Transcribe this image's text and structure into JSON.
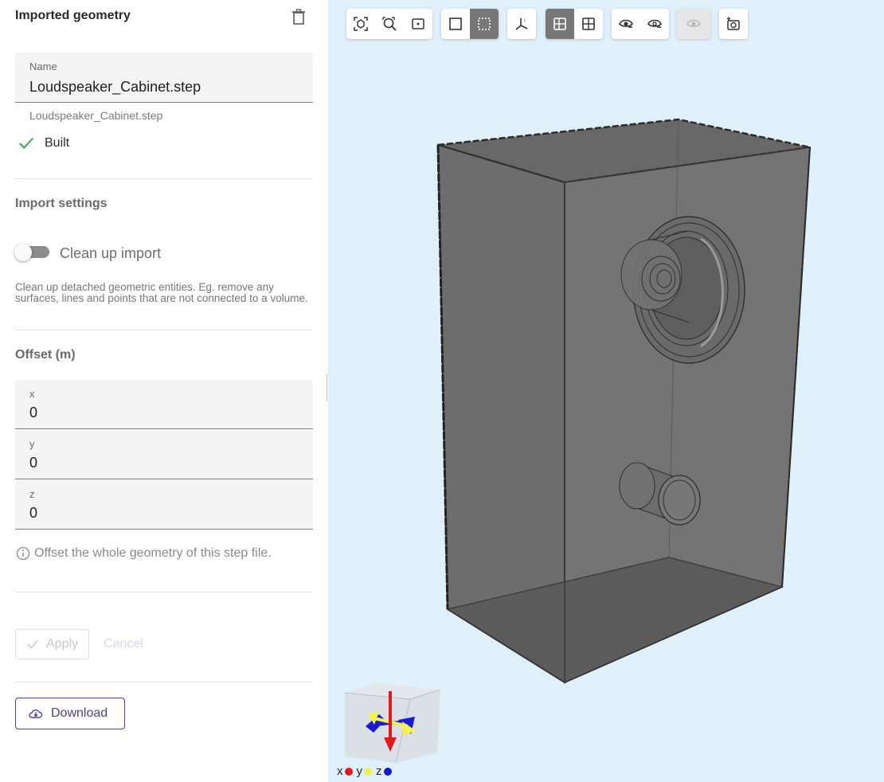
{
  "panel": {
    "title": "Imported geometry",
    "name_field": {
      "label": "Name",
      "value": "Loudspeaker_Cabinet.step"
    },
    "filename": "Loudspeaker_Cabinet.step",
    "status": "Built",
    "import_settings": {
      "title": "Import settings",
      "toggle_label": "Clean up import",
      "toggle_on": false,
      "description": "Clean up detached geometric entities. Eg. remove any surfaces, lines and points that are not connected to a volume."
    },
    "offset": {
      "title": "Offset (m)",
      "fields": [
        {
          "label": "x",
          "value": "0"
        },
        {
          "label": "y",
          "value": "0"
        },
        {
          "label": "z",
          "value": "0"
        }
      ],
      "hint": "Offset the whole geometry of this step file."
    },
    "buttons": {
      "apply": "Apply",
      "cancel": "Cancel",
      "download": "Download"
    }
  },
  "viewer": {
    "toolbar": [
      {
        "group": "view",
        "items": [
          "fit-selection-icon",
          "zoom-fit-icon",
          "zoom-box-icon"
        ]
      },
      {
        "group": "select",
        "items": [
          "select-solid-icon",
          "select-wire-icon"
        ],
        "active": "select-wire-icon"
      },
      {
        "group": "axes",
        "items": [
          "axes-icon"
        ]
      },
      {
        "group": "render",
        "items": [
          "shaded-icon",
          "grid-icon"
        ],
        "active": "shaded-icon"
      },
      {
        "group": "visibility",
        "items": [
          "show-icon",
          "hide-icon"
        ]
      },
      {
        "group": "disabled",
        "items": [
          "show-all-icon"
        ]
      },
      {
        "group": "camera",
        "items": [
          "screenshot-icon"
        ]
      }
    ],
    "axis_legend": [
      {
        "label": "x",
        "color": "#e01b1b"
      },
      {
        "label": "y",
        "color": "#f1f14a"
      },
      {
        "label": "z",
        "color": "#1616d6"
      }
    ]
  },
  "colors": {
    "accent": "#4e3f8f",
    "success": "#3aa757",
    "viewer_bg": "#e0f0fb"
  }
}
